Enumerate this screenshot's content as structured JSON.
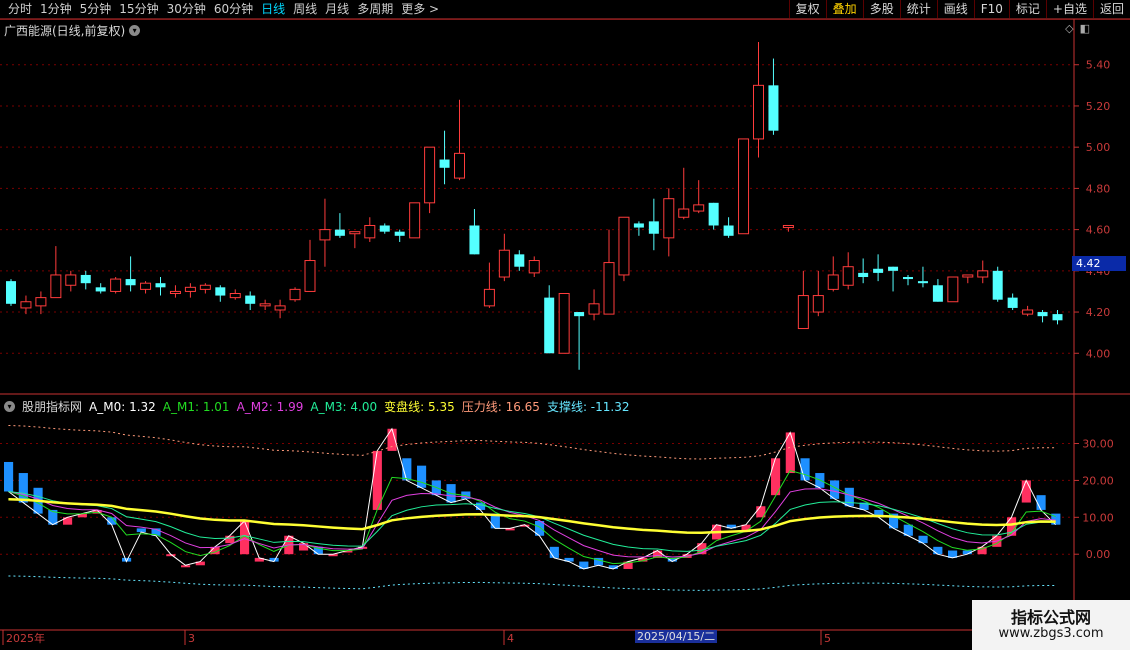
{
  "toolbar": {
    "periods": [
      "分时",
      "1分钟",
      "5分钟",
      "15分钟",
      "30分钟",
      "60分钟",
      "日线",
      "周线",
      "月线",
      "多周期",
      "更多 >"
    ],
    "active_period": "日线",
    "tools": [
      "复权",
      "叠加",
      "多股",
      "统计",
      "画线",
      "F10",
      "标记",
      "+自选",
      "返回"
    ],
    "highlight_tool": "叠加"
  },
  "chart_title": "广西能源(日线,前复权)",
  "price_tag": "4.42",
  "price_axis": [
    "5.40",
    "5.20",
    "5.00",
    "4.80",
    "4.60",
    "4.40",
    "4.20",
    "4.00"
  ],
  "ind_axis": [
    "30.00",
    "20.00",
    "10.00",
    "0.00"
  ],
  "indicator": {
    "name": "股朋指标网",
    "items": [
      {
        "label": "A_M0: 1.32",
        "color": "#ffffff"
      },
      {
        "label": "A_M1: 1.01",
        "color": "#22dd22"
      },
      {
        "label": "A_M2: 1.99",
        "color": "#e040e0"
      },
      {
        "label": "A_M3: 4.00",
        "color": "#22ee99"
      },
      {
        "label": "变盘线: 5.35",
        "color": "#ffff33"
      },
      {
        "label": "压力线: 16.65",
        "color": "#ff9a7a"
      },
      {
        "label": "支撑线: -11.32",
        "color": "#66e6ff"
      }
    ]
  },
  "date_axis": {
    "labels": [
      "2025年",
      "3",
      "4",
      "5"
    ],
    "selected_date": "2025/04/15/二"
  },
  "watermark": {
    "title": "指标公式网",
    "url": "www.zbgs3.com"
  },
  "colors": {
    "up": "#ff3c3c",
    "down": "#54ffff",
    "grid": "#7a0000",
    "axis": "#c83232"
  },
  "chart_data": {
    "type": "candlestick",
    "price_ylim": [
      3.88,
      5.52
    ],
    "indicator_ylim": [
      -20,
      38
    ],
    "candles": [
      [
        4.35,
        4.24,
        4.36,
        4.23
      ],
      [
        4.22,
        4.25,
        4.28,
        4.19
      ],
      [
        4.23,
        4.27,
        4.3,
        4.19
      ],
      [
        4.27,
        4.38,
        4.52,
        4.27
      ],
      [
        4.33,
        4.38,
        4.4,
        4.3
      ],
      [
        4.38,
        4.34,
        4.4,
        4.31
      ],
      [
        4.32,
        4.3,
        4.34,
        4.29
      ],
      [
        4.3,
        4.36,
        4.37,
        4.29
      ],
      [
        4.36,
        4.33,
        4.47,
        4.3
      ],
      [
        4.31,
        4.34,
        4.35,
        4.29
      ],
      [
        4.34,
        4.32,
        4.37,
        4.28
      ],
      [
        4.29,
        4.3,
        4.33,
        4.27
      ],
      [
        4.3,
        4.32,
        4.34,
        4.27
      ],
      [
        4.31,
        4.33,
        4.34,
        4.29
      ],
      [
        4.32,
        4.28,
        4.33,
        4.25
      ],
      [
        4.27,
        4.29,
        4.31,
        4.26
      ],
      [
        4.28,
        4.24,
        4.3,
        4.21
      ],
      [
        4.23,
        4.24,
        4.26,
        4.21
      ],
      [
        4.21,
        4.23,
        4.26,
        4.17
      ],
      [
        4.26,
        4.31,
        4.32,
        4.25
      ],
      [
        4.3,
        4.45,
        4.55,
        4.3
      ],
      [
        4.55,
        4.6,
        4.75,
        4.42
      ],
      [
        4.6,
        4.57,
        4.68,
        4.56
      ],
      [
        4.58,
        4.59,
        4.59,
        4.51
      ],
      [
        4.56,
        4.62,
        4.66,
        4.54
      ],
      [
        4.62,
        4.59,
        4.63,
        4.58
      ],
      [
        4.59,
        4.57,
        4.6,
        4.54
      ],
      [
        4.56,
        4.73,
        4.73,
        4.56
      ],
      [
        4.73,
        5.0,
        5.0,
        4.68
      ],
      [
        4.94,
        4.9,
        5.08,
        4.82
      ],
      [
        4.85,
        4.97,
        5.23,
        4.84
      ],
      [
        4.62,
        4.48,
        4.7,
        4.48
      ],
      [
        4.23,
        4.31,
        4.44,
        4.22
      ],
      [
        4.37,
        4.5,
        4.58,
        4.35
      ],
      [
        4.48,
        4.42,
        4.5,
        4.4
      ],
      [
        4.39,
        4.45,
        4.47,
        4.37
      ],
      [
        4.27,
        4.0,
        4.33,
        4.0
      ],
      [
        4.0,
        4.29,
        4.29,
        4.0
      ],
      [
        4.2,
        4.18,
        4.2,
        3.92
      ],
      [
        4.19,
        4.24,
        4.31,
        4.16
      ],
      [
        4.19,
        4.44,
        4.6,
        4.19
      ],
      [
        4.38,
        4.66,
        4.66,
        4.35
      ],
      [
        4.63,
        4.61,
        4.64,
        4.57
      ],
      [
        4.64,
        4.58,
        4.75,
        4.5
      ],
      [
        4.56,
        4.75,
        4.8,
        4.47
      ],
      [
        4.66,
        4.7,
        4.9,
        4.65
      ],
      [
        4.69,
        4.72,
        4.84,
        4.68
      ],
      [
        4.73,
        4.62,
        4.73,
        4.6
      ],
      [
        4.62,
        4.57,
        4.66,
        4.56
      ],
      [
        4.58,
        5.04,
        5.04,
        4.58
      ],
      [
        5.04,
        5.3,
        5.51,
        4.95
      ],
      [
        5.3,
        5.08,
        5.43,
        5.06
      ],
      [
        4.61,
        4.62,
        4.62,
        4.59
      ],
      [
        4.12,
        4.28,
        4.4,
        4.12
      ],
      [
        4.2,
        4.28,
        4.4,
        4.18
      ],
      [
        4.31,
        4.38,
        4.47,
        4.3
      ],
      [
        4.33,
        4.42,
        4.49,
        4.31
      ],
      [
        4.39,
        4.37,
        4.46,
        4.34
      ],
      [
        4.41,
        4.39,
        4.48,
        4.35
      ],
      [
        4.42,
        4.4,
        4.42,
        4.3
      ],
      [
        4.37,
        4.36,
        4.38,
        4.33
      ],
      [
        4.35,
        4.34,
        4.42,
        4.32
      ],
      [
        4.33,
        4.25,
        4.36,
        4.25
      ],
      [
        4.25,
        4.37,
        4.37,
        4.25
      ],
      [
        4.37,
        4.38,
        4.38,
        4.34
      ],
      [
        4.37,
        4.4,
        4.45,
        4.34
      ],
      [
        4.4,
        4.26,
        4.42,
        4.25
      ],
      [
        4.27,
        4.22,
        4.29,
        4.21
      ],
      [
        4.19,
        4.21,
        4.23,
        4.18
      ],
      [
        4.2,
        4.18,
        4.21,
        4.15
      ],
      [
        4.19,
        4.16,
        4.21,
        4.14
      ]
    ],
    "ind_bars": [
      [
        25,
        17
      ],
      [
        22,
        14
      ],
      [
        18,
        11
      ],
      [
        12,
        8
      ],
      [
        8,
        10
      ],
      [
        10,
        11
      ],
      [
        11,
        12
      ],
      [
        10,
        8
      ],
      [
        -1,
        -2
      ],
      [
        7,
        6
      ],
      [
        7,
        5
      ],
      [
        0,
        0
      ],
      [
        -3,
        -3
      ],
      [
        -3,
        -2
      ],
      [
        0,
        2
      ],
      [
        3,
        5
      ],
      [
        0,
        9
      ],
      [
        -2,
        -1
      ],
      [
        -1,
        -2
      ],
      [
        0,
        5
      ],
      [
        1,
        3
      ],
      [
        2,
        0
      ],
      [
        0,
        0
      ],
      [
        1,
        1
      ],
      [
        2,
        2
      ],
      [
        12,
        28
      ],
      [
        28,
        34
      ],
      [
        26,
        20
      ],
      [
        24,
        18
      ],
      [
        20,
        16
      ],
      [
        19,
        14
      ],
      [
        17,
        15
      ],
      [
        14,
        12
      ],
      [
        11,
        7
      ],
      [
        7,
        7
      ],
      [
        8,
        8
      ],
      [
        9,
        5
      ],
      [
        2,
        -1
      ],
      [
        -1,
        -2
      ],
      [
        -2,
        -4
      ],
      [
        -1,
        -3
      ],
      [
        -3,
        -4
      ],
      [
        -4,
        -2
      ],
      [
        -2,
        -1
      ],
      [
        -1,
        1
      ],
      [
        -1,
        -2
      ],
      [
        -1,
        0
      ],
      [
        0,
        3
      ],
      [
        4,
        8
      ],
      [
        8,
        7
      ],
      [
        6,
        8
      ],
      [
        10,
        13
      ],
      [
        16,
        26
      ],
      [
        22,
        33
      ],
      [
        26,
        20
      ],
      [
        22,
        18
      ],
      [
        20,
        15
      ],
      [
        18,
        13
      ],
      [
        14,
        12
      ],
      [
        12,
        10
      ],
      [
        11,
        7
      ],
      [
        8,
        5
      ],
      [
        5,
        3
      ],
      [
        2,
        0
      ],
      [
        1,
        -1
      ],
      [
        1,
        0
      ],
      [
        0,
        2
      ],
      [
        2,
        5
      ],
      [
        5,
        10
      ],
      [
        14,
        20
      ],
      [
        16,
        12
      ],
      [
        11,
        8
      ]
    ]
  }
}
